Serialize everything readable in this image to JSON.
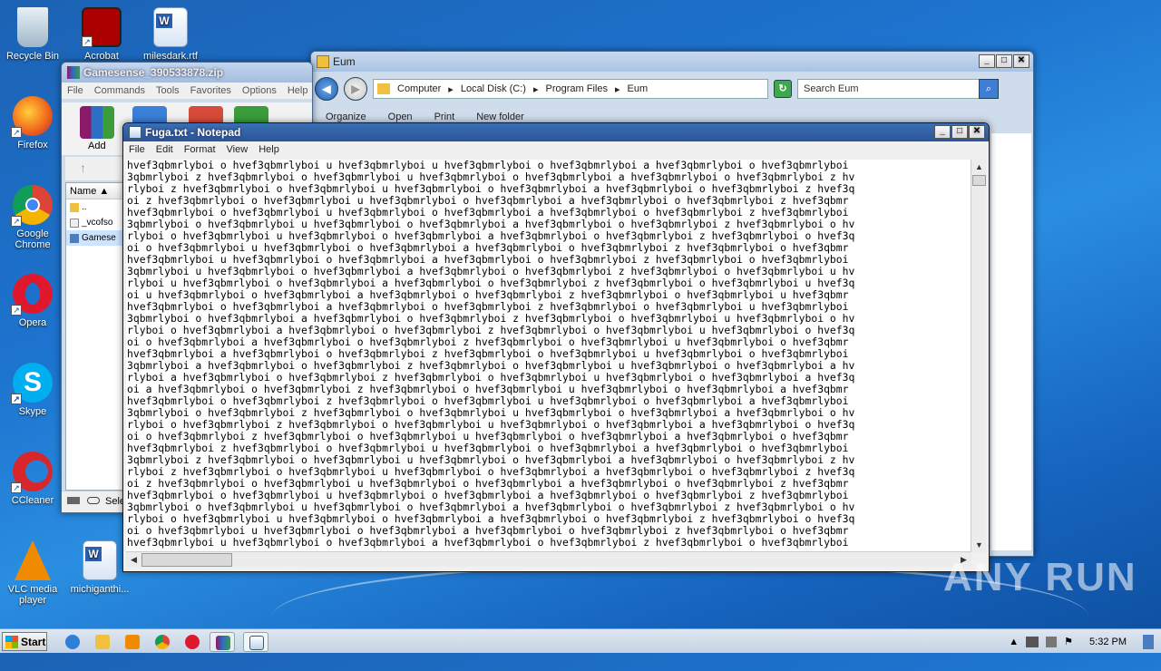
{
  "desktop": {
    "icons": [
      {
        "label": "Recycle Bin",
        "icon": "recycle-bin-icon"
      },
      {
        "label": "Acrobat",
        "icon": "acrobat-icon"
      },
      {
        "label": "milesdark.rtf",
        "icon": "word-doc-icon"
      },
      {
        "label": "Firefox",
        "icon": "firefox-icon"
      },
      {
        "label": "Google Chrome",
        "icon": "chrome-icon"
      },
      {
        "label": "Opera",
        "icon": "opera-icon"
      },
      {
        "label": "Skype",
        "icon": "skype-icon"
      },
      {
        "label": "CCleaner",
        "icon": "ccleaner-icon"
      },
      {
        "label": "VLC media player",
        "icon": "vlc-icon"
      },
      {
        "label": "michiganthi...",
        "icon": "word-doc-icon"
      }
    ],
    "watermark": "ANY RUN"
  },
  "winrar": {
    "title": "Gamesense_390533878.zip",
    "menu": [
      "File",
      "Commands",
      "Tools",
      "Favorites",
      "Options",
      "Help"
    ],
    "add_label": "Add",
    "column_name": "Name",
    "files": [
      {
        "name": ".."
      },
      {
        "name": "_vcofso"
      },
      {
        "name": "Gamese"
      }
    ],
    "status_text": "Sele"
  },
  "explorer": {
    "title": "Eum",
    "breadcrumb": [
      "Computer",
      "Local Disk (C:)",
      "Program Files",
      "Eum"
    ],
    "search_placeholder": "Search Eum",
    "toolbar": [
      "Organize",
      "Open",
      "Print",
      "New folder"
    ]
  },
  "notepad": {
    "title": "Fuga.txt - Notepad",
    "menu": [
      "File",
      "Edit",
      "Format",
      "View",
      "Help"
    ],
    "lines": [
      "hvef3qbmrlyboi o hvef3qbmrlyboi u hvef3qbmrlyboi u hvef3qbmrlyboi o hvef3qbmrlyboi a hvef3qbmrlyboi o hvef3qbmrlyboi",
      "3qbmrlyboi z hvef3qbmrlyboi o hvef3qbmrlyboi u hvef3qbmrlyboi o hvef3qbmrlyboi a hvef3qbmrlyboi o hvef3qbmrlyboi z hv",
      "rlyboi z hvef3qbmrlyboi o hvef3qbmrlyboi u hvef3qbmrlyboi o hvef3qbmrlyboi a hvef3qbmrlyboi o hvef3qbmrlyboi z hvef3q",
      "oi z hvef3qbmrlyboi o hvef3qbmrlyboi u hvef3qbmrlyboi o hvef3qbmrlyboi a hvef3qbmrlyboi o hvef3qbmrlyboi z hvef3qbmr",
      "hvef3qbmrlyboi o hvef3qbmrlyboi u hvef3qbmrlyboi o hvef3qbmrlyboi a hvef3qbmrlyboi o hvef3qbmrlyboi z hvef3qbmrlyboi",
      "3qbmrlyboi o hvef3qbmrlyboi u hvef3qbmrlyboi o hvef3qbmrlyboi a hvef3qbmrlyboi o hvef3qbmrlyboi z hvef3qbmrlyboi o hv",
      "rlyboi o hvef3qbmrlyboi u hvef3qbmrlyboi o hvef3qbmrlyboi a hvef3qbmrlyboi o hvef3qbmrlyboi z hvef3qbmrlyboi o hvef3q",
      "oi o hvef3qbmrlyboi u hvef3qbmrlyboi o hvef3qbmrlyboi a hvef3qbmrlyboi o hvef3qbmrlyboi z hvef3qbmrlyboi o hvef3qbmr",
      "hvef3qbmrlyboi u hvef3qbmrlyboi o hvef3qbmrlyboi a hvef3qbmrlyboi o hvef3qbmrlyboi z hvef3qbmrlyboi o hvef3qbmrlyboi",
      "3qbmrlyboi u hvef3qbmrlyboi o hvef3qbmrlyboi a hvef3qbmrlyboi o hvef3qbmrlyboi z hvef3qbmrlyboi o hvef3qbmrlyboi u hv",
      "rlyboi u hvef3qbmrlyboi o hvef3qbmrlyboi a hvef3qbmrlyboi o hvef3qbmrlyboi z hvef3qbmrlyboi o hvef3qbmrlyboi u hvef3q",
      "oi u hvef3qbmrlyboi o hvef3qbmrlyboi a hvef3qbmrlyboi o hvef3qbmrlyboi z hvef3qbmrlyboi o hvef3qbmrlyboi u hvef3qbmr",
      "hvef3qbmrlyboi o hvef3qbmrlyboi a hvef3qbmrlyboi o hvef3qbmrlyboi z hvef3qbmrlyboi o hvef3qbmrlyboi u hvef3qbmrlyboi",
      "3qbmrlyboi o hvef3qbmrlyboi a hvef3qbmrlyboi o hvef3qbmrlyboi z hvef3qbmrlyboi o hvef3qbmrlyboi u hvef3qbmrlyboi o hv",
      "rlyboi o hvef3qbmrlyboi a hvef3qbmrlyboi o hvef3qbmrlyboi z hvef3qbmrlyboi o hvef3qbmrlyboi u hvef3qbmrlyboi o hvef3q",
      "oi o hvef3qbmrlyboi a hvef3qbmrlyboi o hvef3qbmrlyboi z hvef3qbmrlyboi o hvef3qbmrlyboi u hvef3qbmrlyboi o hvef3qbmr",
      "hvef3qbmrlyboi a hvef3qbmrlyboi o hvef3qbmrlyboi z hvef3qbmrlyboi o hvef3qbmrlyboi u hvef3qbmrlyboi o hvef3qbmrlyboi",
      "3qbmrlyboi a hvef3qbmrlyboi o hvef3qbmrlyboi z hvef3qbmrlyboi o hvef3qbmrlyboi u hvef3qbmrlyboi o hvef3qbmrlyboi a hv",
      "rlyboi a hvef3qbmrlyboi o hvef3qbmrlyboi z hvef3qbmrlyboi o hvef3qbmrlyboi u hvef3qbmrlyboi o hvef3qbmrlyboi a hvef3q",
      "oi a hvef3qbmrlyboi o hvef3qbmrlyboi z hvef3qbmrlyboi o hvef3qbmrlyboi u hvef3qbmrlyboi o hvef3qbmrlyboi a hvef3qbmr",
      "hvef3qbmrlyboi o hvef3qbmrlyboi z hvef3qbmrlyboi o hvef3qbmrlyboi u hvef3qbmrlyboi o hvef3qbmrlyboi a hvef3qbmrlyboi",
      "3qbmrlyboi o hvef3qbmrlyboi z hvef3qbmrlyboi o hvef3qbmrlyboi u hvef3qbmrlyboi o hvef3qbmrlyboi a hvef3qbmrlyboi o hv",
      "rlyboi o hvef3qbmrlyboi z hvef3qbmrlyboi o hvef3qbmrlyboi u hvef3qbmrlyboi o hvef3qbmrlyboi a hvef3qbmrlyboi o hvef3q",
      "oi o hvef3qbmrlyboi z hvef3qbmrlyboi o hvef3qbmrlyboi u hvef3qbmrlyboi o hvef3qbmrlyboi a hvef3qbmrlyboi o hvef3qbmr",
      "hvef3qbmrlyboi z hvef3qbmrlyboi o hvef3qbmrlyboi u hvef3qbmrlyboi o hvef3qbmrlyboi a hvef3qbmrlyboi o hvef3qbmrlyboi",
      "3qbmrlyboi z hvef3qbmrlyboi o hvef3qbmrlyboi u hvef3qbmrlyboi o hvef3qbmrlyboi a hvef3qbmrlyboi o hvef3qbmrlyboi z hv",
      "rlyboi z hvef3qbmrlyboi o hvef3qbmrlyboi u hvef3qbmrlyboi o hvef3qbmrlyboi a hvef3qbmrlyboi o hvef3qbmrlyboi z hvef3q",
      "oi z hvef3qbmrlyboi o hvef3qbmrlyboi u hvef3qbmrlyboi o hvef3qbmrlyboi a hvef3qbmrlyboi o hvef3qbmrlyboi z hvef3qbmr",
      "hvef3qbmrlyboi o hvef3qbmrlyboi u hvef3qbmrlyboi o hvef3qbmrlyboi a hvef3qbmrlyboi o hvef3qbmrlyboi z hvef3qbmrlyboi",
      "3qbmrlyboi o hvef3qbmrlyboi u hvef3qbmrlyboi o hvef3qbmrlyboi a hvef3qbmrlyboi o hvef3qbmrlyboi z hvef3qbmrlyboi o hv",
      "rlyboi o hvef3qbmrlyboi u hvef3qbmrlyboi o hvef3qbmrlyboi a hvef3qbmrlyboi o hvef3qbmrlyboi z hvef3qbmrlyboi o hvef3q",
      "oi o hvef3qbmrlyboi u hvef3qbmrlyboi o hvef3qbmrlyboi a hvef3qbmrlyboi o hvef3qbmrlyboi z hvef3qbmrlyboi o hvef3qbmr",
      "hvef3qbmrlyboi u hvef3qbmrlyboi o hvef3qbmrlyboi a hvef3qbmrlyboi o hvef3qbmrlyboi z hvef3qbmrlyboi o hvef3qbmrlyboi"
    ]
  },
  "taskbar": {
    "start_label": "Start",
    "clock": "5:32 PM",
    "items": [
      "ie-icon",
      "explorer-icon",
      "media-player-icon",
      "chrome-icon",
      "opera-icon",
      "winrar-icon",
      "notepad-icon"
    ]
  }
}
